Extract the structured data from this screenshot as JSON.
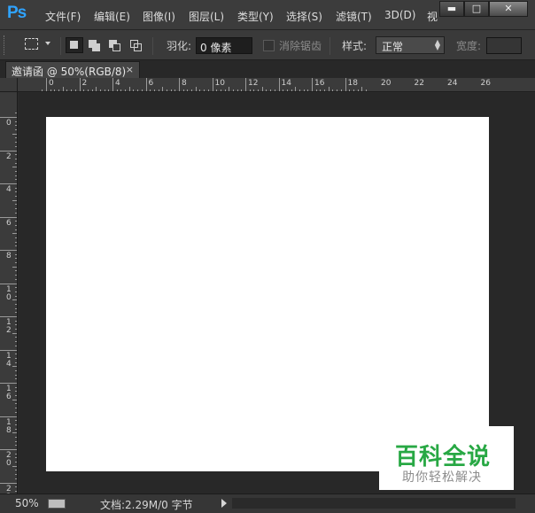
{
  "app": {
    "logo": "Ps"
  },
  "menubar": {
    "items": [
      "文件(F)",
      "编辑(E)",
      "图像(I)",
      "图层(L)",
      "类型(Y)",
      "选择(S)",
      "滤镜(T)",
      "3D(D)",
      "视"
    ],
    "window_controls": {
      "minimize": "▬",
      "restore": "□",
      "close": "✕"
    }
  },
  "options": {
    "tool_preset_icon": "rect-marquee-icon",
    "selection_modes": [
      "new-selection",
      "add-to-selection",
      "subtract-from-selection",
      "intersect-selection"
    ],
    "feather_label": "羽化:",
    "feather_value": "0 像素",
    "antialias_label": "消除锯齿",
    "style_label": "样式:",
    "style_value": "正常",
    "width_label": "宽度:",
    "width_value": ""
  },
  "document_tab": {
    "title": "邀请函 @ 50%(RGB/8)",
    "close": "×"
  },
  "rulers": {
    "top_labels": [
      "0",
      "2",
      "4",
      "6",
      "8",
      "10",
      "12",
      "14",
      "16",
      "18",
      "20",
      "22",
      "24",
      "26"
    ],
    "left_labels": [
      "0",
      "2",
      "4",
      "6",
      "8",
      "10",
      "12",
      "14",
      "16",
      "18",
      "20",
      "22"
    ]
  },
  "statusbar": {
    "zoom": "50%",
    "doc_info": "文档:2.29M/0 字节"
  },
  "watermark": {
    "title": "百科全说",
    "subtitle": "助你轻松解决"
  },
  "colors": {
    "accent": "#2fa3ff",
    "watermark_green": "#28a844",
    "canvas": "#ffffff"
  }
}
